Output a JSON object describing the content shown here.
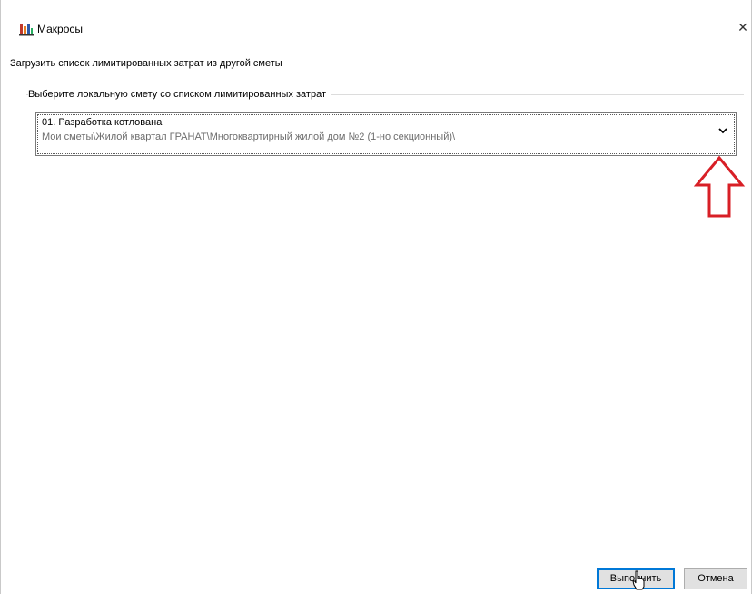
{
  "window": {
    "title": "Макросы",
    "icon": "chart-app-icon",
    "close_glyph": "✕"
  },
  "instruction": "Загрузить список лимитированных затрат из другой сметы",
  "group": {
    "label": "Выберите локальную смету со списком лимитированных затрат"
  },
  "estimate_select": {
    "name": "01. Разработка котлована",
    "path": "Мои сметы\\Жилой квартал ГРАНАТ\\Многоквартирный жилой дом №2 (1-но секционный)\\",
    "dropdown_icon": "chevron-down-icon"
  },
  "annotation": {
    "icon": "arrow-up-icon",
    "color": "#d81f26"
  },
  "buttons": {
    "run": "Выполнить",
    "cancel": "Отмена"
  },
  "colors": {
    "focus_border": "#0078d7",
    "button_bg": "#e1e1e1"
  }
}
